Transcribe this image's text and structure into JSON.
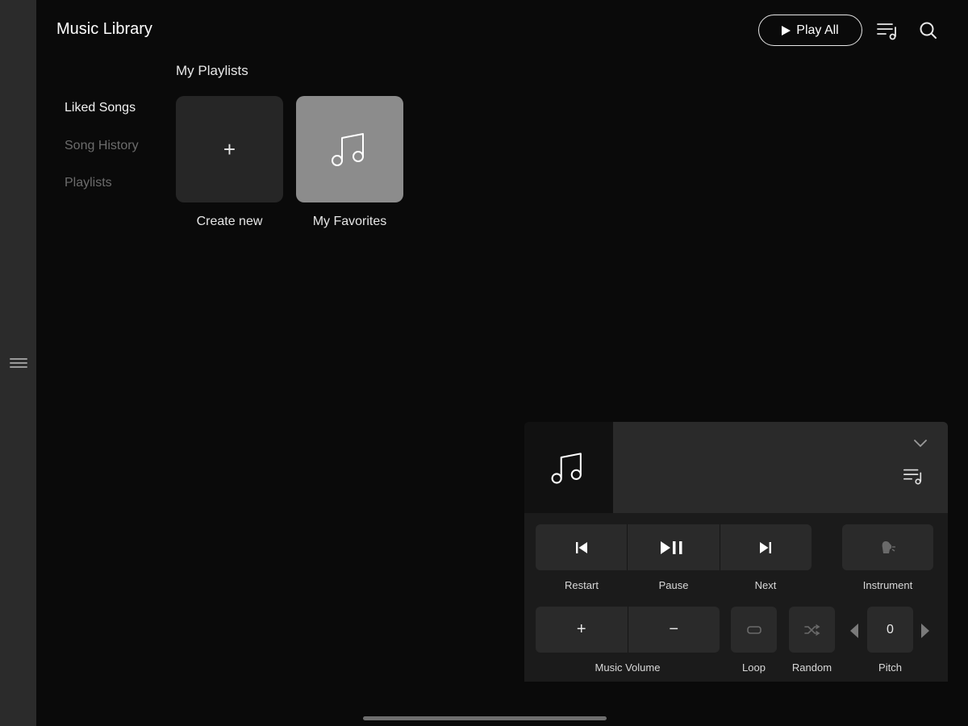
{
  "header": {
    "title": "Music Library",
    "play_all_label": "Play All"
  },
  "sidebar": {
    "items": [
      {
        "label": "Liked Songs",
        "active": true
      },
      {
        "label": "Song History",
        "active": false
      },
      {
        "label": "Playlists",
        "active": false
      }
    ]
  },
  "main": {
    "section_title": "My Playlists",
    "tiles": [
      {
        "label": "Create new",
        "icon": "plus-icon"
      },
      {
        "label": "My Favorites",
        "icon": "music-note-icon"
      }
    ]
  },
  "player": {
    "controls": {
      "restart_label": "Restart",
      "pause_label": "Pause",
      "next_label": "Next",
      "instrument_label": "Instrument"
    },
    "volume_label": "Music Volume",
    "volume_up": "+",
    "volume_down": "−",
    "loop_label": "Loop",
    "random_label": "Random",
    "pitch_label": "Pitch",
    "pitch_value": "0"
  },
  "colors": {
    "background": "#0a0a0a",
    "rail": "#2b2b2b",
    "panel": "#1b1b1b",
    "button": "#2a2a2a",
    "favorites_tile": "#8c8c8c"
  }
}
